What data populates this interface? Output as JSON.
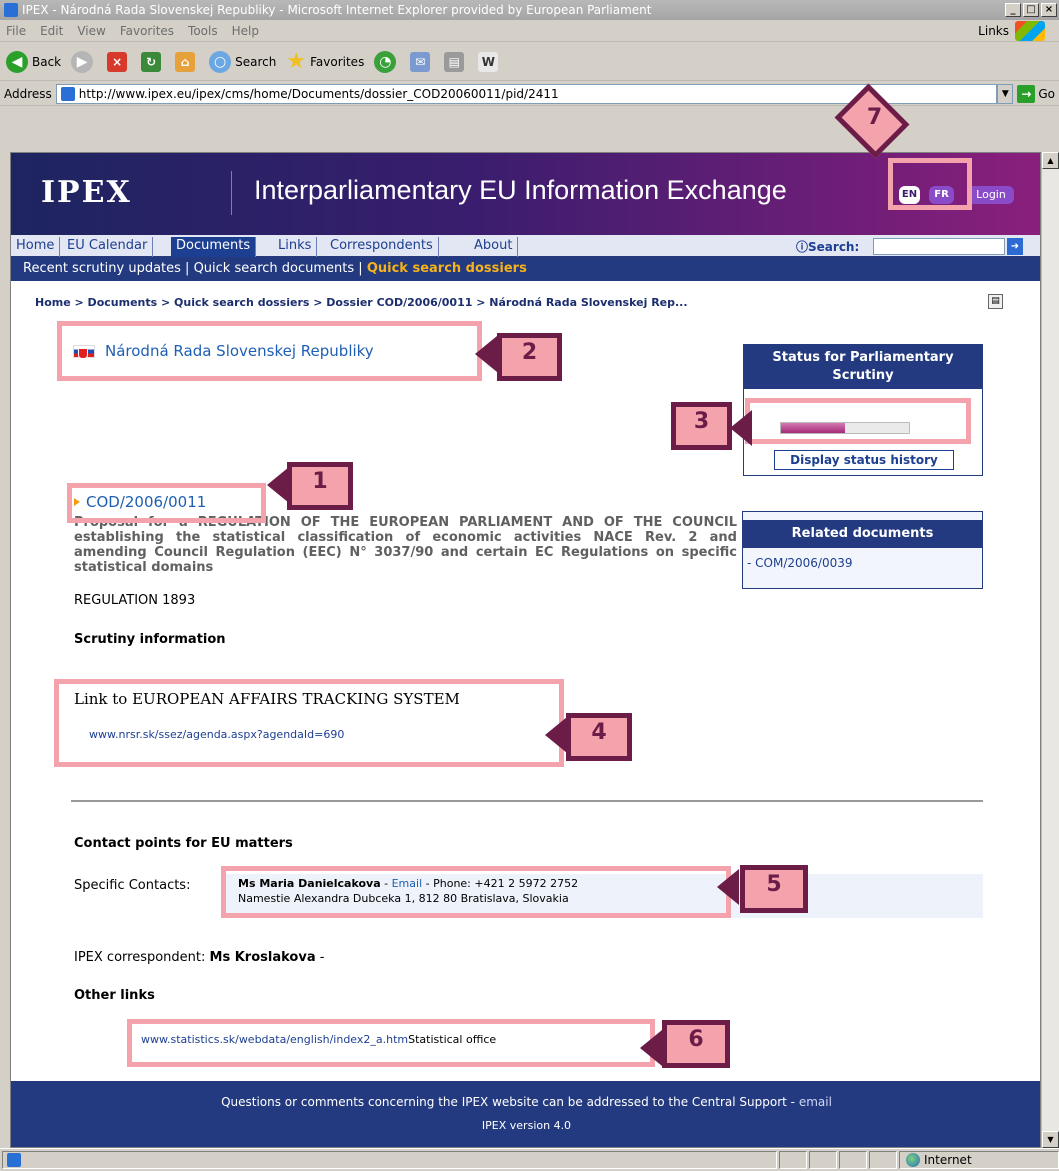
{
  "window": {
    "title": "IPEX - Národná Rada Slovenskej Republiky - Microsoft Internet Explorer provided by European Parliament",
    "min": "_",
    "max": "□",
    "close": "×"
  },
  "menubar": {
    "items": [
      "File",
      "Edit",
      "View",
      "Favorites",
      "Tools",
      "Help"
    ],
    "links": "Links"
  },
  "toolbar": {
    "back": "Back",
    "search": "Search",
    "favorites": "Favorites"
  },
  "addressbar": {
    "label": "Address",
    "url": "http://www.ipex.eu/ipex/cms/home/Documents/dossier_COD20060011/pid/2411",
    "go": "Go"
  },
  "header": {
    "logo": "IPEX",
    "title": "Interparliamentary EU Information Exchange",
    "lang_en": "EN",
    "lang_fr": "FR",
    "login": "Login"
  },
  "nav": {
    "tabs": [
      "Home",
      "EU Calendar",
      "Documents",
      "Links",
      "Correspondents",
      "About"
    ],
    "active": "Documents",
    "search_label": "Search:"
  },
  "subnav": {
    "item1": "Recent scrutiny updates",
    "item2": "Quick search documents",
    "item3": "Quick search dossiers",
    "sep": " | "
  },
  "breadcrumb": "Home  >  Documents  >  Quick search dossiers  >  Dossier COD/2006/0011  >  Národná Rada Slovenskej Rep...",
  "country": "Národná Rada Slovenskej Republiky",
  "status": {
    "title": "Status for Parliamentary Scrutiny",
    "progress": 0.5,
    "button": "Display status history"
  },
  "dossier": {
    "id": "COD/2006/0011",
    "proposal": "Proposal for a REGULATION OF THE EUROPEAN PARLIAMENT AND OF THE COUNCIL establishing the statistical classification of economic activities NACE Rev. 2 and amending Council Regulation (EEC) N° 3037/90 and certain EC Regulations on specific statistical domains",
    "regulation": "REGULATION  1893"
  },
  "related": {
    "title": "Related documents",
    "item": "- COM/2006/0039"
  },
  "scrutiny": {
    "title": "Scrutiny information",
    "link_title": "Link to EUROPEAN AFFAIRS TRACKING SYSTEM",
    "link_url": "www.nrsr.sk/ssez/agenda.aspx?agendaId=690"
  },
  "contacts": {
    "title": "Contact points for EU matters",
    "label": "Specific Contacts:",
    "name": "Ms Maria Danielcakova",
    "sep1": "  -  ",
    "email": "Email",
    "phone": "  -  Phone: +421 2 5972 2752",
    "address": "Namestie Alexandra Dubceka 1, 812 80 Bratislava, Slovakia"
  },
  "correspondent": {
    "label": "IPEX correspondent: ",
    "name": "Ms Kroslakova",
    "tail": "  -"
  },
  "other_links": {
    "title": "Other links",
    "url": "www.statistics.sk/webdata/english/index2_a.htm",
    "text": "Statistical office"
  },
  "footer": {
    "line1": "Questions or comments concerning the IPEX website can be addressed to the Central Support - ",
    "email": "email",
    "line2": "IPEX version 4.0"
  },
  "annotations": [
    "1",
    "2",
    "3",
    "4",
    "5",
    "6",
    "7"
  ],
  "statusbar": {
    "zone": "Internet"
  },
  "colors": {
    "annotation_fill": "#f4a3ad",
    "annotation_border": "#6b1d47",
    "ipex_blue": "#233a80",
    "link_blue": "#1e5fb4",
    "highlight_orange": "#f5b21a"
  }
}
